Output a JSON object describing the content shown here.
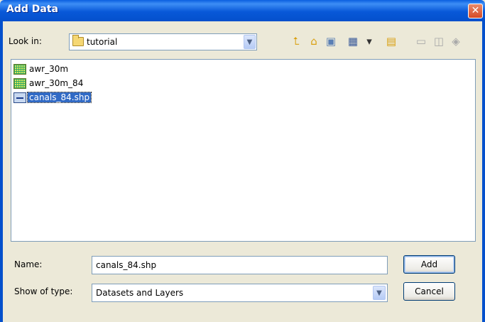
{
  "window": {
    "title": "Add Data",
    "close_glyph": "✕"
  },
  "look_in": {
    "label": "Look in:",
    "value": "tutorial",
    "icon": "folder-icon"
  },
  "toolbar": [
    {
      "name": "up-one-level-icon",
      "glyph": "⮤",
      "enabled": true,
      "color": "#d9a011"
    },
    {
      "name": "home-icon",
      "glyph": "⌂",
      "enabled": true,
      "color": "#d9a011"
    },
    {
      "name": "connect-folder-icon",
      "glyph": "▣",
      "enabled": true,
      "color": "#5a7fb5"
    },
    {
      "name": "view-list-icon",
      "glyph": "▦",
      "enabled": true,
      "color": "#3a5a9a"
    },
    {
      "name": "view-dropdown-icon",
      "glyph": "▾",
      "enabled": true,
      "color": "#333333"
    },
    {
      "name": "new-folder-icon",
      "glyph": "▤",
      "enabled": true,
      "color": "#d9a011"
    },
    {
      "name": "new-geodatabase-icon",
      "glyph": "▭",
      "enabled": false,
      "color": "#a9a9a9"
    },
    {
      "name": "new-shapefile-icon",
      "glyph": "◫",
      "enabled": false,
      "color": "#a9a9a9"
    },
    {
      "name": "catalog-icon",
      "glyph": "◈",
      "enabled": false,
      "color": "#a9a9a9"
    }
  ],
  "files": [
    {
      "name": "awr_30m",
      "type": "raster",
      "selected": false
    },
    {
      "name": "awr_30m_84",
      "type": "raster",
      "selected": false
    },
    {
      "name": "canals_84.shp",
      "type": "shapefile",
      "selected": true
    }
  ],
  "name_field": {
    "label": "Name:",
    "value": "canals_84.shp"
  },
  "type_field": {
    "label": "Show of type:",
    "value": "Datasets and Layers"
  },
  "buttons": {
    "add": "Add",
    "cancel": "Cancel"
  },
  "dropdown_glyph": "⌄"
}
